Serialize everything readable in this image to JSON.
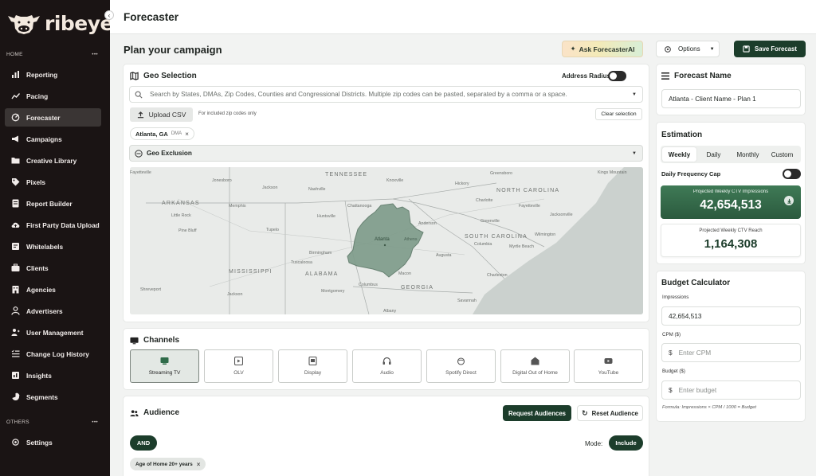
{
  "brand": {
    "name": "ribeye",
    "accent": "#1c3d2b"
  },
  "sidebar": {
    "section_home": "HOME",
    "section_others": "OTHERS",
    "items": [
      {
        "label": "Reporting",
        "icon": "reporting-icon"
      },
      {
        "label": "Pacing",
        "icon": "trend-icon"
      },
      {
        "label": "Forecaster",
        "icon": "forecast-icon",
        "active": true
      },
      {
        "label": "Campaigns",
        "icon": "megaphone-icon"
      },
      {
        "label": "Creative Library",
        "icon": "folder-icon"
      },
      {
        "label": "Pixels",
        "icon": "tag-icon"
      },
      {
        "label": "Report Builder",
        "icon": "report-builder-icon"
      },
      {
        "label": "First Party Data Upload",
        "icon": "cloud-upload-icon"
      },
      {
        "label": "Whitelabels",
        "icon": "whitelabel-icon"
      },
      {
        "label": "Clients",
        "icon": "briefcase-icon"
      },
      {
        "label": "Agencies",
        "icon": "building-icon"
      },
      {
        "label": "Advertisers",
        "icon": "person-icon"
      },
      {
        "label": "User Management",
        "icon": "user-management-icon"
      },
      {
        "label": "Change Log History",
        "icon": "list-icon"
      },
      {
        "label": "Insights",
        "icon": "insights-icon"
      },
      {
        "label": "Segments",
        "icon": "segments-icon"
      }
    ],
    "others": [
      {
        "label": "Settings",
        "icon": "gear-icon"
      }
    ]
  },
  "header": {
    "title": "Forecaster"
  },
  "main": {
    "plan_title": "Plan your campaign",
    "ask_label": "Ask ForecasterAI",
    "options_label": "Options",
    "save_label": "Save Forecast"
  },
  "geo": {
    "title": "Geo Selection",
    "address_radius_label": "Address Radius",
    "search_placeholder": "Search by States, DMAs, Zip Codes, Counties and Congressional Districts. Multiple zip codes can be pasted, separated by a comma or a space.",
    "upload_label": "Upload CSV",
    "upload_note": "For included zip codes only",
    "clear_label": "Clear selection",
    "selected": {
      "name": "Atlanta, GA",
      "type": "DMA"
    },
    "exclusion_label": "Geo Exclusion",
    "map_labels": {
      "states": [
        "TENNESSEE",
        "ARKANSAS",
        "MISSISSIPPI",
        "ALABAMA",
        "GEORGIA",
        "SOUTH CAROLINA",
        "NORTH CAROLINA"
      ],
      "cities": [
        "Fayetteville",
        "Jonesboro",
        "Jackson",
        "Memphis",
        "Nashville",
        "Knoxville",
        "Greensboro",
        "Kings Mountain",
        "Hickory",
        "Charlotte",
        "Fayetteville",
        "Little Rock",
        "Pine Bluff",
        "Huntsville",
        "Chattanooga",
        "Tupelo",
        "Anderson",
        "Greenville",
        "Jacksonville",
        "Wilmington",
        "Columbia",
        "Myrtle Beach",
        "Atlanta",
        "Athens",
        "Birmingham",
        "Tuscaloosa",
        "Augusta",
        "Charleston",
        "Macon",
        "Montgomery",
        "Columbus",
        "Shreveport",
        "Jackson",
        "Savannah",
        "Albany"
      ]
    }
  },
  "channels": {
    "title": "Channels",
    "items": [
      {
        "label": "Streaming TV",
        "active": true
      },
      {
        "label": "OLV"
      },
      {
        "label": "Display"
      },
      {
        "label": "Audio"
      },
      {
        "label": "Spotify Direct"
      },
      {
        "label": "Digital Out of Home"
      },
      {
        "label": "YouTube"
      }
    ]
  },
  "audience": {
    "title": "Audience",
    "request_label": "Request Audiences",
    "reset_label": "Reset Audience",
    "logic": "AND",
    "mode_label": "Mode:",
    "mode_value": "Include",
    "tags": [
      "Age of Home 20+ years"
    ]
  },
  "forecast_name": {
    "title": "Forecast Name",
    "value": "Atlanta - Client Name - Plan 1"
  },
  "estimation": {
    "title": "Estimation",
    "tabs": [
      "Weekly",
      "Daily",
      "Monthly",
      "Custom"
    ],
    "active_tab": "Weekly",
    "frequency_cap_label": "Daily Frequency Cap",
    "impressions_label": "Projected Weekly CTV Impressions",
    "impressions_value": "42,654,513",
    "reach_label": "Projected Weekly CTV Reach",
    "reach_value": "1,164,308"
  },
  "budget": {
    "title": "Budget Calculator",
    "impressions_label": "Impressions",
    "impressions_value": "42,654,513",
    "cpm_label": "CPM ($)",
    "cpm_placeholder": "Enter CPM",
    "budget_label": "Budget ($)",
    "budget_placeholder": "Enter budget",
    "currency": "$",
    "formula": "Formula: Impressions × CPM / 1000 = Budget"
  }
}
